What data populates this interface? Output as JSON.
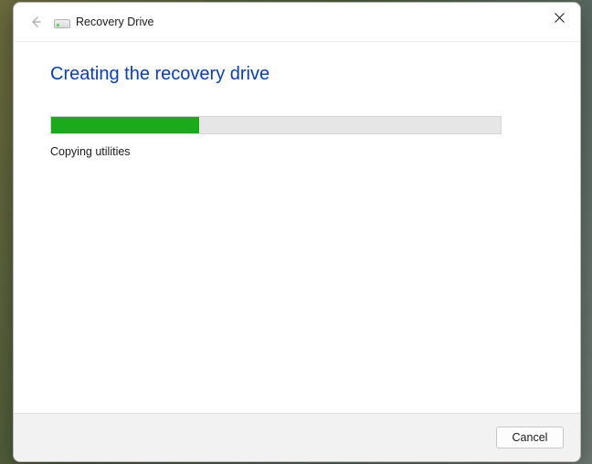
{
  "window": {
    "title": "Recovery Drive",
    "icon": "drive-icon"
  },
  "content": {
    "heading": "Creating the recovery drive",
    "progress_percent": 33,
    "status_text": "Copying utilities"
  },
  "footer": {
    "cancel_label": "Cancel"
  }
}
